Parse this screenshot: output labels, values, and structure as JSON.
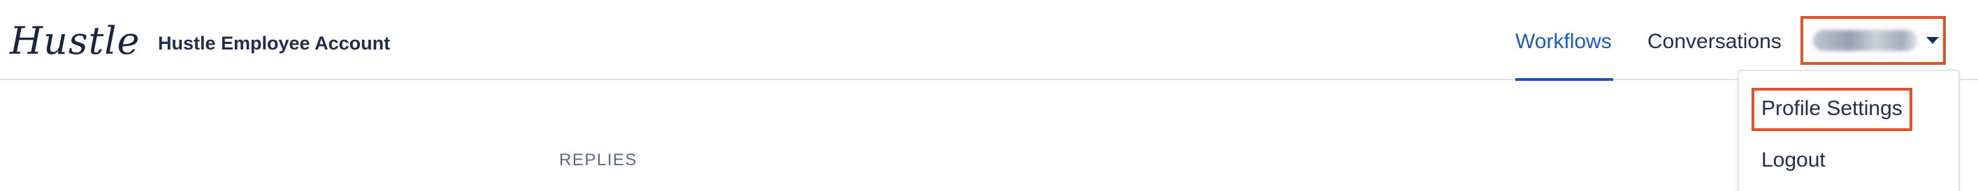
{
  "header": {
    "logo": "Hustle",
    "account_name": "Hustle Employee Account",
    "nav": [
      {
        "label": "Workflows",
        "active": true
      },
      {
        "label": "Conversations",
        "active": false
      }
    ]
  },
  "user_menu": {
    "menu": [
      {
        "label": "Profile Settings",
        "highlighted": true
      },
      {
        "label": "Logout",
        "highlighted": false
      }
    ]
  },
  "main": {
    "section_label": "REPLIES"
  },
  "colors": {
    "accent": "#1f56c4",
    "highlight_box": "#e05227",
    "text": "#1f2d4e"
  }
}
